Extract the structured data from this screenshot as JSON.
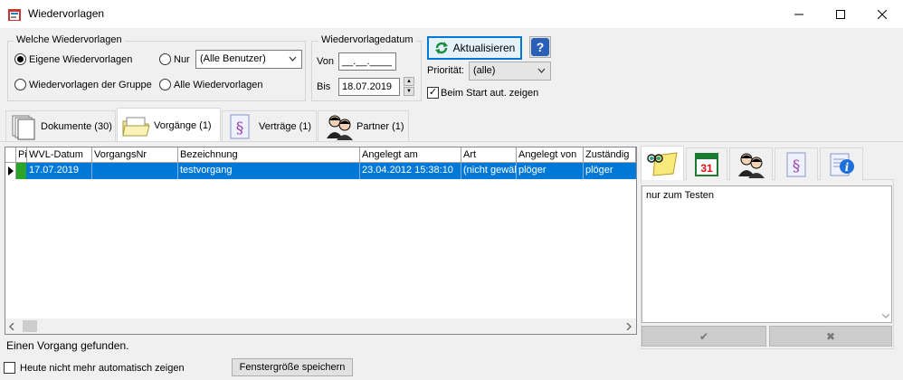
{
  "window": {
    "title": "Wiedervorlagen",
    "minimize": "—",
    "maximize": "☐",
    "close": "✕"
  },
  "filter": {
    "legend": "Welche Wiedervorlagen",
    "own": "Eigene Wiedervorlagen",
    "only": "Nur",
    "user_select": "(Alle Benutzer)",
    "group": "Wiedervorlagen der Gruppe",
    "all": "Alle Wiedervorlagen"
  },
  "date": {
    "legend": "Wiedervorlagedatum",
    "from_label": "Von",
    "from_value": "__.__.____",
    "to_label": "Bis",
    "to_value": "18.07.2019"
  },
  "actions": {
    "refresh": "Aktualisieren",
    "help": "?",
    "priority_label": "Priorität:",
    "priority_value": "(alle)",
    "autostart_label": "Beim Start aut. zeigen"
  },
  "tabs": [
    {
      "label": "Dokumente (30)"
    },
    {
      "label": "Vorgänge (1)"
    },
    {
      "label": "Verträge (1)"
    },
    {
      "label": "Partner (1)"
    }
  ],
  "grid": {
    "columns": [
      "Pi",
      "WVL-Datum",
      "VorgangsNr",
      "Bezeichnung",
      "Angelegt am",
      "Art",
      "Angelegt von",
      "Zuständig"
    ],
    "rows": [
      {
        "pi": "",
        "wvl_datum": "17.07.2019",
        "vorgangsnr": "",
        "bezeichnung": "testvorgang",
        "angelegt_am": "23.04.2012 15:38:10",
        "art": "(nicht gewäl",
        "angelegt_von": "plöger",
        "zustaendig": "plöger"
      }
    ]
  },
  "status": "Einen Vorgang gefunden.",
  "memo": {
    "text": "nur zum Testen",
    "ok_icon": "✔",
    "cancel_icon": "✖"
  },
  "footer": {
    "no_auto_label": "Heute nicht mehr automatisch zeigen",
    "save_size": "Fenstergröße speichern"
  },
  "colors": {
    "selection": "#0078d7",
    "accent": "#0078d7"
  }
}
